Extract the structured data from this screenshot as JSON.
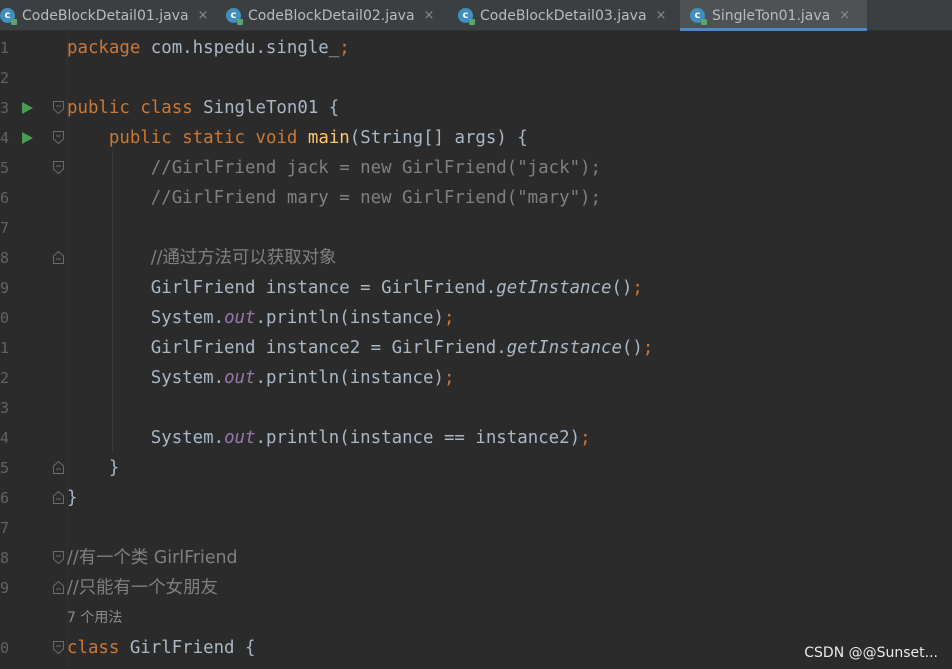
{
  "tabs": [
    {
      "label": "CodeBlockDetail01.java",
      "icon": "java-class-icon",
      "active": false
    },
    {
      "label": "CodeBlockDetail02.java",
      "icon": "java-class-icon",
      "active": false
    },
    {
      "label": "CodeBlockDetail03.java",
      "icon": "java-class-icon",
      "active": false
    },
    {
      "label": "SingleTon01.java",
      "icon": "java-class-icon",
      "active": true
    }
  ],
  "tab_close_glyph": "×",
  "tab_icon_letter": "c",
  "line_numbers": [
    "1",
    "2",
    "3",
    "4",
    "5",
    "6",
    "7",
    "8",
    "9",
    "0",
    "1",
    "2",
    "3",
    "4",
    "5",
    "6",
    "7",
    "8",
    "9",
    "0"
  ],
  "code": {
    "l1": {
      "kw": "package",
      "rest": " com.hspedu.single_",
      "semi": ";"
    },
    "l3": {
      "kw1": "public",
      "sp1": " ",
      "kw2": "class",
      "rest": " SingleTon01 {"
    },
    "l4": {
      "indent": "    ",
      "kw1": "public",
      "sp1": " ",
      "kw2": "static",
      "sp2": " ",
      "kw3": "void",
      "sp3": " ",
      "fn": "main",
      "rest": "(String[] args) {"
    },
    "l5": {
      "indent": "        ",
      "comment": "//GirlFriend jack = new GirlFriend(\"jack\");"
    },
    "l6": {
      "indent": "        ",
      "comment": "//GirlFriend mary = new GirlFriend(\"mary\");"
    },
    "l8": {
      "indent": "        ",
      "comment": "//通过方法可以获取对象"
    },
    "l9": {
      "indent": "        ",
      "pre": "GirlFriend instance = GirlFriend.",
      "method": "getInstance",
      "post": "()",
      "semi": ";"
    },
    "l10": {
      "indent": "        ",
      "pre": "System.",
      "field": "out",
      "post": ".println(instance)",
      "semi": ";"
    },
    "l11": {
      "indent": "        ",
      "pre": "GirlFriend instance2 = GirlFriend.",
      "method": "getInstance",
      "post": "()",
      "semi": ";"
    },
    "l12": {
      "indent": "        ",
      "pre": "System.",
      "field": "out",
      "post": ".println(instance)",
      "semi": ";"
    },
    "l14": {
      "indent": "        ",
      "pre": "System.",
      "field": "out",
      "post": ".println(instance == instance2)",
      "semi": ";"
    },
    "l15": {
      "indent": "    ",
      "text": "}"
    },
    "l16": {
      "text": "}"
    },
    "l18": {
      "comment": "//有一个类 GirlFriend"
    },
    "l19": {
      "comment": "//只能有一个女朋友"
    },
    "usages": "7 个用法",
    "l20": {
      "kw": "class",
      "rest": " GirlFriend {"
    }
  },
  "watermark": "CSDN @@Sunset...",
  "colors": {
    "background": "#2b2b2b",
    "keyword": "#cc7832",
    "function": "#ffc66d",
    "comment": "#808080",
    "static_field": "#9876aa",
    "plain": "#a9b7c6",
    "run_icon": "#499c54",
    "active_tab_underline": "#4a88c7"
  }
}
